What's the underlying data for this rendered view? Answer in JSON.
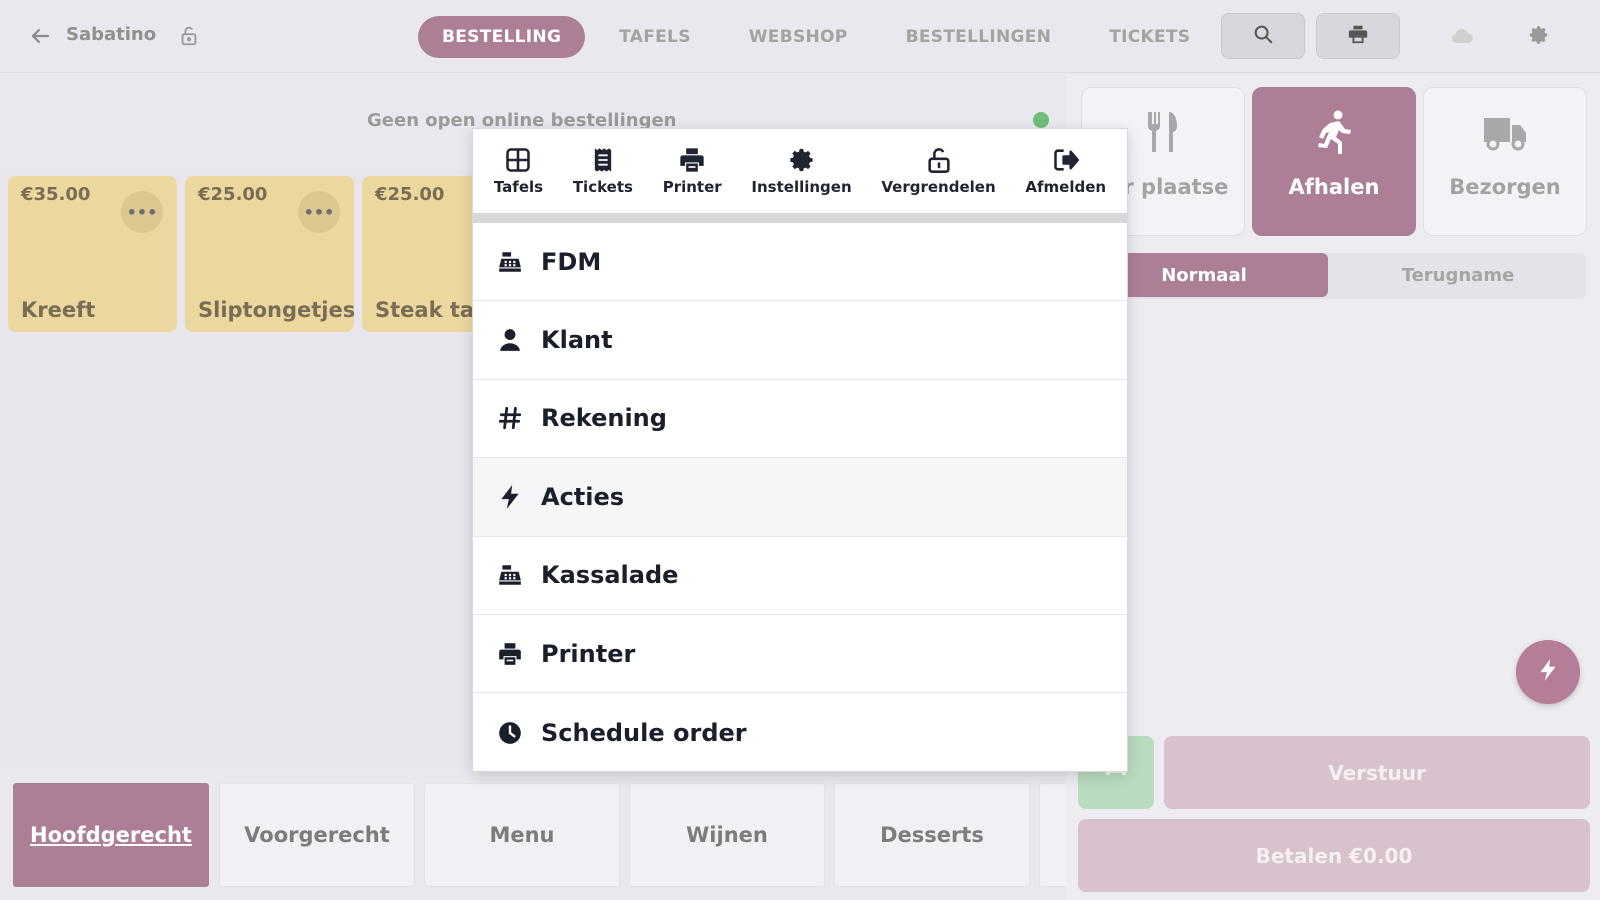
{
  "header": {
    "shop_name": "Sabatino",
    "tabs": [
      {
        "label": "BESTELLING",
        "active": true
      },
      {
        "label": "TAFELS",
        "active": false
      },
      {
        "label": "WEBSHOP",
        "active": false
      },
      {
        "label": "BESTELLINGEN",
        "active": false
      },
      {
        "label": "TICKETS",
        "active": false
      }
    ]
  },
  "online": {
    "status_text": "Geen open online bestellingen"
  },
  "products": [
    {
      "price": "€35.00",
      "name": "Kreeft"
    },
    {
      "price": "€25.00",
      "name": "Sliptongetjes"
    },
    {
      "price": "€25.00",
      "name": "Steak tar"
    }
  ],
  "categories": [
    {
      "label": "Hoofdgerecht",
      "active": true
    },
    {
      "label": "Voorgerecht",
      "active": false
    },
    {
      "label": "Menu",
      "active": false
    },
    {
      "label": "Wijnen",
      "active": false
    },
    {
      "label": "Desserts",
      "active": false
    }
  ],
  "order_modes": [
    {
      "label": "Ter plaatse",
      "icon": "cutlery-icon",
      "active": false
    },
    {
      "label": "Afhalen",
      "icon": "running-person-icon",
      "active": true
    },
    {
      "label": "Bezorgen",
      "icon": "truck-icon",
      "active": false
    }
  ],
  "segment": {
    "options": [
      "Normaal",
      "Terugname"
    ],
    "selected": "Normaal"
  },
  "actions": {
    "send_label": "Verstuur",
    "pay_label": "Betalen €0.00"
  },
  "menu": {
    "quick_actions": [
      {
        "label": "Tafels",
        "icon": "table-grid-icon"
      },
      {
        "label": "Tickets",
        "icon": "receipt-icon"
      },
      {
        "label": "Printer",
        "icon": "printer-icon"
      },
      {
        "label": "Instellingen",
        "icon": "gear-icon"
      },
      {
        "label": "Vergrendelen",
        "icon": "unlock-icon"
      },
      {
        "label": "Afmelden",
        "icon": "sign-out-icon"
      }
    ],
    "items": [
      {
        "label": "FDM",
        "icon": "cash-register-icon"
      },
      {
        "label": "Klant",
        "icon": "user-icon"
      },
      {
        "label": "Rekening",
        "icon": "hashtag-icon"
      },
      {
        "label": "Acties",
        "icon": "bolt-icon"
      },
      {
        "label": "Kassalade",
        "icon": "cash-register-icon"
      },
      {
        "label": "Printer",
        "icon": "printer-icon"
      },
      {
        "label": "Schedule order",
        "icon": "clock-icon"
      }
    ]
  },
  "colors": {
    "accent": "#ad7f96",
    "product_tile": "#ecd79f",
    "online_dot": "#6dbf7a"
  }
}
